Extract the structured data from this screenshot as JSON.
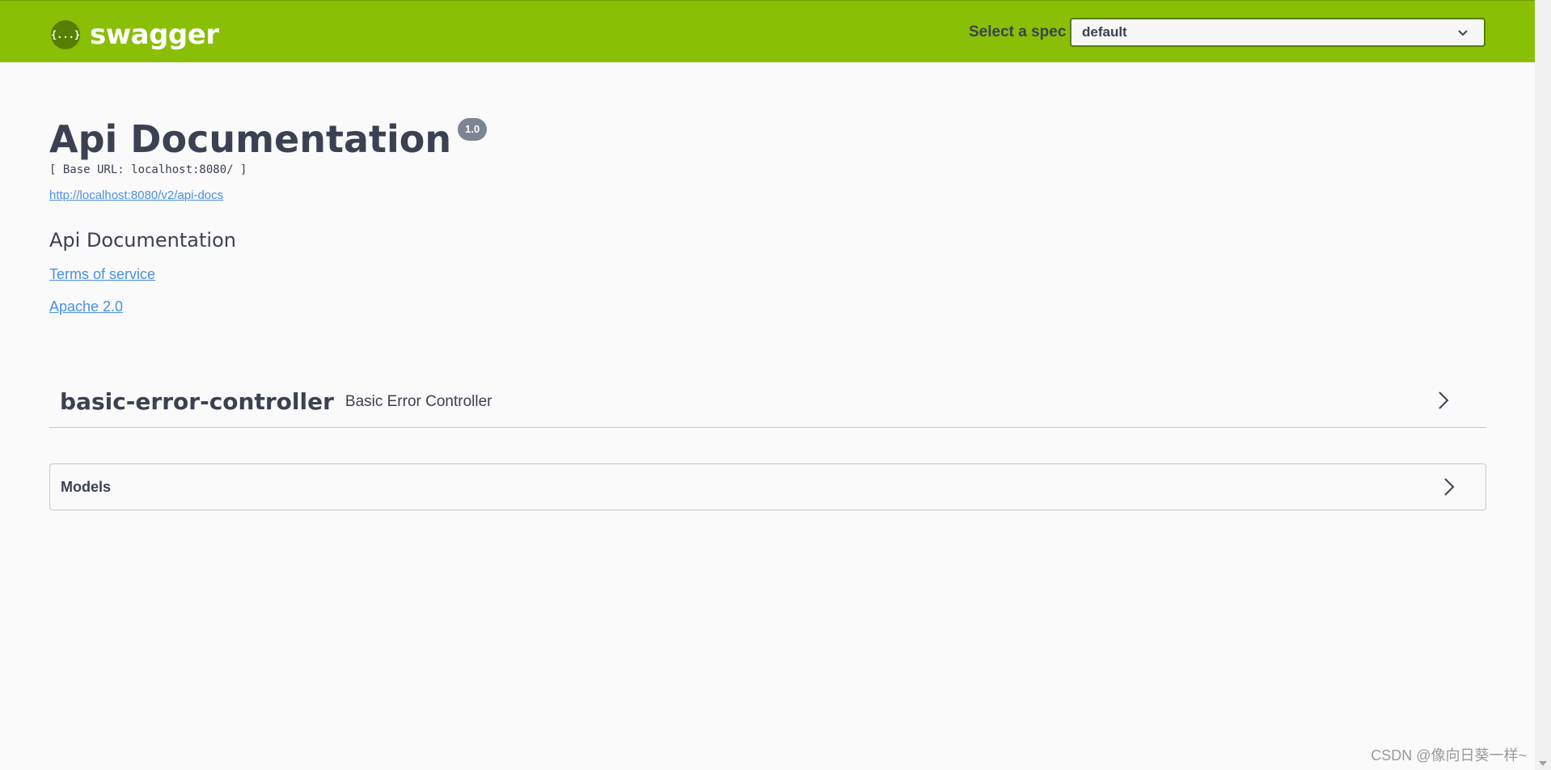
{
  "topbar": {
    "logo_text": "swagger",
    "logo_badge": "{...}",
    "spec_label": "Select a spec",
    "spec_selected": "default"
  },
  "info": {
    "title": "Api Documentation",
    "version": "1.0",
    "base_url": "[ Base URL: localhost:8080/ ]",
    "docs_url": "http://localhost:8080/v2/api-docs",
    "description": "Api Documentation",
    "terms_label": "Terms of service",
    "license_label": "Apache 2.0"
  },
  "tags": [
    {
      "name": "basic-error-controller",
      "description": "Basic Error Controller"
    }
  ],
  "models": {
    "title": "Models"
  },
  "watermark": "CSDN @像向日葵一样~",
  "colors": {
    "topbar_bg": "#89bf04",
    "accent_dark": "#547f00",
    "text": "#3b4151",
    "link": "#4990e2",
    "version_badge": "#7d8492"
  }
}
